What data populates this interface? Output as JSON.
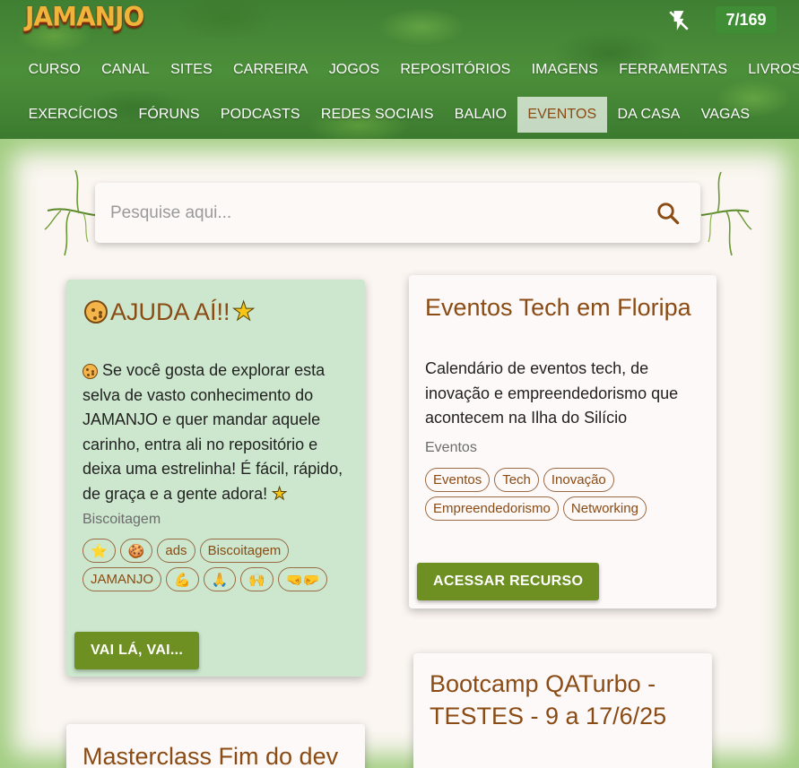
{
  "header": {
    "logo": "JAMANJO",
    "counter": "7/169",
    "nav_row1": [
      "CURSO",
      "CANAL",
      "SITES",
      "CARREIRA",
      "JOGOS",
      "REPOSITÓRIOS",
      "IMAGENS",
      "FERRAMENTAS",
      "LIVROS"
    ],
    "nav_row2": [
      "EXERCÍCIOS",
      "FÓRUNS",
      "PODCASTS",
      "REDES SOCIAIS",
      "BALAIO",
      "EVENTOS",
      "DA CASA",
      "VAGAS"
    ],
    "active_nav": "EVENTOS",
    "flash_icon": "flash-off-icon"
  },
  "search": {
    "placeholder": "Pesquise aqui...",
    "icon": "search-icon"
  },
  "cards": [
    {
      "title": "AJUDA AÍ!!",
      "description": "Se você gosta de explorar esta selva de vasto conhecimento do JAMANJO e quer mandar aquele carinho, entra ali no repositório e deixa uma estrelinha! É fácil, rápido, de graça e a gente adora!",
      "category": "Biscoitagem",
      "tags": [
        "⭐",
        "🍪",
        "ads",
        "Biscoitagem",
        "JAMANJO",
        "💪",
        "🙏",
        "🙌",
        "🤜🤛"
      ],
      "button": "VAI LÁ, VAI...",
      "background": "#cce7cd"
    },
    {
      "title": "Eventos Tech em Floripa",
      "description": "Calendário de eventos tech, de inovação e empreendedorismo que acontecem na Ilha do Silício",
      "category": "Eventos",
      "tags": [
        "Eventos",
        "Tech",
        "Inovação",
        "Empreendedorismo",
        "Networking"
      ],
      "button": "ACESSAR RECURSO"
    },
    {
      "title": "Bootcamp QATurbo - TESTES - 9 a 17/6/25"
    },
    {
      "title": "Masterclass Fim do dev"
    }
  ],
  "colors": {
    "accent_brown": "#8a4b14",
    "button_green": "#6e8f22",
    "header_green": "#3f7f33"
  }
}
